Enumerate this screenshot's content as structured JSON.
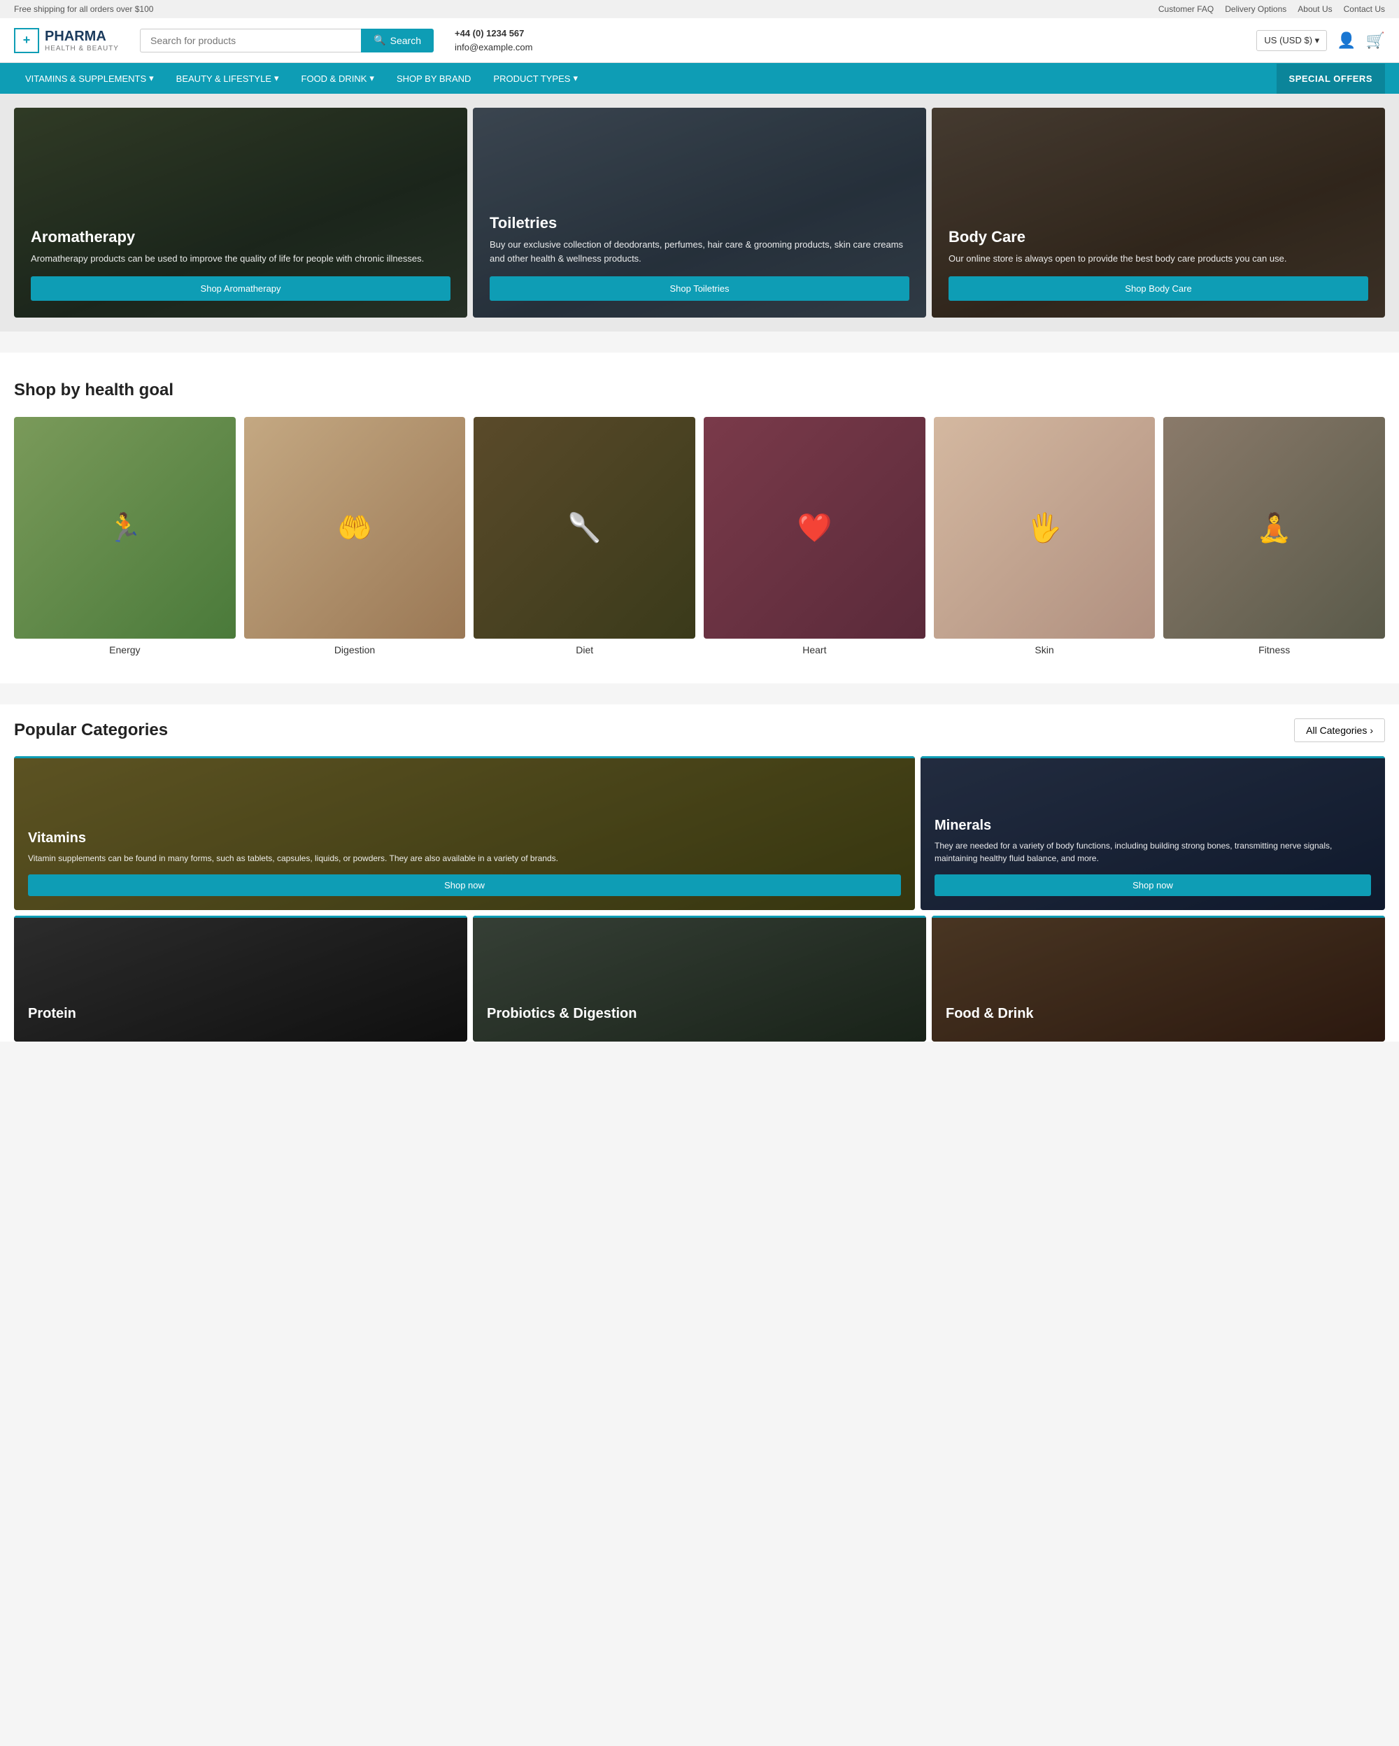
{
  "topbar": {
    "shipping_text": "Free shipping for all orders over $100",
    "links": [
      "Customer FAQ",
      "Delivery Options",
      "About Us",
      "Contact Us"
    ]
  },
  "header": {
    "logo": {
      "brand": "PHARMA",
      "sub": "HEALTH & BEAUTY",
      "icon": "+"
    },
    "search": {
      "placeholder": "Search for products",
      "button_label": "Search"
    },
    "phone": "+44 (0) 1234 567",
    "email": "info@example.com",
    "currency": "US (USD $)",
    "currency_arrow": "▾"
  },
  "nav": {
    "items": [
      {
        "label": "VITAMINS & SUPPLEMENTS",
        "has_dropdown": true
      },
      {
        "label": "BEAUTY & LIFESTYLE",
        "has_dropdown": true
      },
      {
        "label": "FOOD & DRINK",
        "has_dropdown": true
      },
      {
        "label": "SHOP BY BRAND",
        "has_dropdown": false
      },
      {
        "label": "PRODUCT TYPES",
        "has_dropdown": true
      }
    ],
    "special": "SPECIAL OFFERS"
  },
  "hero": {
    "cards": [
      {
        "id": "aromatherapy",
        "title": "Aromatherapy",
        "description": "Aromatherapy products can be used to improve the quality of life for people with chronic illnesses.",
        "button_label": "Shop Aromatherapy",
        "bg": "#556655"
      },
      {
        "id": "toiletries",
        "title": "Toiletries",
        "description": "Buy our exclusive collection of deodorants, perfumes, hair care & grooming products, skin care creams and other health & wellness products.",
        "button_label": "Shop Toiletries",
        "bg": "#667788"
      },
      {
        "id": "bodycare",
        "title": "Body Care",
        "description": "Our online store is always open to provide the best body care products you can use.",
        "button_label": "Shop Body Care",
        "bg": "#776655"
      }
    ]
  },
  "health_goals": {
    "title": "Shop by health goal",
    "items": [
      {
        "label": "Energy",
        "icon": "🏃",
        "color_class": "hg-energy"
      },
      {
        "label": "Digestion",
        "icon": "🤲",
        "color_class": "hg-digestion"
      },
      {
        "label": "Diet",
        "icon": "🥗",
        "color_class": "hg-diet"
      },
      {
        "label": "Heart",
        "icon": "❤️",
        "color_class": "hg-heart"
      },
      {
        "label": "Skin",
        "icon": "🖐️",
        "color_class": "hg-skin"
      },
      {
        "label": "Fitness",
        "icon": "💪",
        "color_class": "hg-fitness"
      }
    ]
  },
  "categories": {
    "title": "Popular Categories",
    "all_label": "All Categories",
    "top_row": [
      {
        "id": "vitamins",
        "title": "Vitamins",
        "description": "Vitamin supplements can be found in many forms, such as tablets, capsules, liquids, or powders. They are also available in a variety of brands.",
        "button_label": "Shop now",
        "bg": "#8a7a2a",
        "wide": true
      },
      {
        "id": "minerals",
        "title": "Minerals",
        "description": "They are needed for a variety of body functions, including building strong bones, transmitting nerve signals, maintaining healthy fluid balance, and more.",
        "button_label": "Shop now",
        "bg": "#3a4a6a",
        "wide": false
      }
    ],
    "bottom_row": [
      {
        "id": "protein",
        "title": "Protein",
        "description": "",
        "bg": "#3a3a3a"
      },
      {
        "id": "probiotics",
        "title": "Probiotics & Digestion",
        "description": "",
        "bg": "#4a5a4a"
      },
      {
        "id": "fooddrink",
        "title": "Food & Drink",
        "description": "",
        "bg": "#6a4a2a"
      }
    ]
  }
}
